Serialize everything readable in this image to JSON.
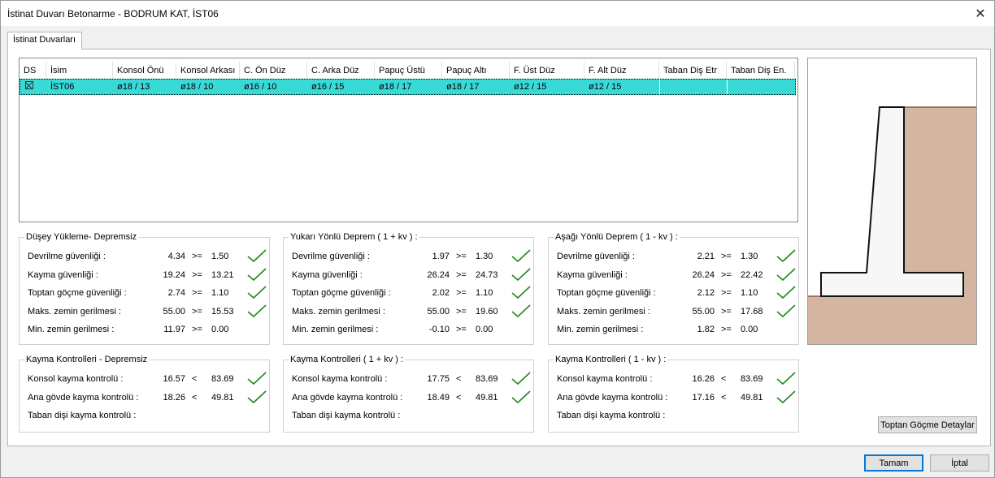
{
  "window": {
    "title": "İstinat Duvarı Betonarme - BODRUM KAT, İST06",
    "close_glyph": "✕"
  },
  "tab": {
    "label": "İstinat Duvarları"
  },
  "grid": {
    "columns": [
      "DS",
      "İsim",
      "Konsol Önü",
      "Konsol Arkası",
      "C. Ön Düz",
      "C. Arka Düz",
      "Papuç Üstü",
      "Papuç Altı",
      "F. Üst Düz",
      "F. Alt Düz",
      "Taban Diş Etr",
      "Taban Diş En."
    ],
    "row": {
      "name": "İST06",
      "konsol_onu": "ø18 / 13",
      "konsol_arkasi": "ø18 / 10",
      "c_on_duz": "ø16 / 10",
      "c_arka_duz": "ø16 / 15",
      "papuc_ustu": "ø18 / 17",
      "papuc_alti": "ø18 / 17",
      "f_ust_duz": "ø12 / 15",
      "f_alt_duz": "ø12 / 15",
      "taban_dis_etr": "",
      "taban_dis_en": ""
    }
  },
  "groups": {
    "dusey": {
      "title": "Düşey Yükleme- Depremsiz",
      "rows": [
        {
          "label": "Devrilme güvenliği :",
          "v1": "4.34",
          "op": ">=",
          "v2": "1.50"
        },
        {
          "label": "Kayma güvenliği :",
          "v1": "19.24",
          "op": ">=",
          "v2": "13.21"
        },
        {
          "label": "Toptan göçme güvenliği :",
          "v1": "2.74",
          "op": ">=",
          "v2": "1.10"
        },
        {
          "label": "Maks. zemin gerilmesi :",
          "v1": "55.00",
          "op": ">=",
          "v2": "15.53"
        },
        {
          "label": "Min. zemin gerilmesi :",
          "v1": "11.97",
          "op": ">=",
          "v2": "0.00"
        }
      ]
    },
    "yukari": {
      "title": "Yukarı Yönlü Deprem ( 1 + kv ) :",
      "rows": [
        {
          "label": "Devrilme güvenliği :",
          "v1": "1.97",
          "op": ">=",
          "v2": "1.30"
        },
        {
          "label": "Kayma güvenliği :",
          "v1": "26.24",
          "op": ">=",
          "v2": "24.73"
        },
        {
          "label": "Toptan göçme güvenliği :",
          "v1": "2.02",
          "op": ">=",
          "v2": "1.10"
        },
        {
          "label": "Maks. zemin gerilmesi :",
          "v1": "55.00",
          "op": ">=",
          "v2": "19.60"
        },
        {
          "label": "Min. zemin gerilmesi :",
          "v1": "-0.10",
          "op": ">=",
          "v2": "0.00"
        }
      ]
    },
    "asagi": {
      "title": "Aşağı Yönlü Deprem ( 1 - kv ) :",
      "rows": [
        {
          "label": "Devrilme güvenliği :",
          "v1": "2.21",
          "op": ">=",
          "v2": "1.30"
        },
        {
          "label": "Kayma güvenliği :",
          "v1": "26.24",
          "op": ">=",
          "v2": "22.42"
        },
        {
          "label": "Toptan göçme güvenliği :",
          "v1": "2.12",
          "op": ">=",
          "v2": "1.10"
        },
        {
          "label": "Maks. zemin gerilmesi :",
          "v1": "55.00",
          "op": ">=",
          "v2": "17.68"
        },
        {
          "label": "Min. zemin gerilmesi :",
          "v1": "1.82",
          "op": ">=",
          "v2": "0.00"
        }
      ]
    },
    "kayma_depremsiz": {
      "title": "Kayma Kontrolleri - Depremsiz",
      "rows": [
        {
          "label": "Konsol kayma kontrolü :",
          "v1": "16.57",
          "op": "<",
          "v2": "83.69"
        },
        {
          "label": "Ana gövde kayma kontrolü :",
          "v1": "18.26",
          "op": "<",
          "v2": "49.81"
        },
        {
          "label": "Taban dişi kayma kontrolü :",
          "v1": "",
          "op": "",
          "v2": ""
        }
      ]
    },
    "kayma_yukari": {
      "title": "Kayma Kontrolleri  ( 1 + kv ) :",
      "rows": [
        {
          "label": "Konsol kayma kontrolü :",
          "v1": "17.75",
          "op": "<",
          "v2": "83.69"
        },
        {
          "label": "Ana gövde kayma kontrolü :",
          "v1": "18.49",
          "op": "<",
          "v2": "49.81"
        },
        {
          "label": "Taban dişi kayma kontrolü :",
          "v1": "",
          "op": "",
          "v2": ""
        }
      ]
    },
    "kayma_asagi": {
      "title": "Kayma Kontrolleri  ( 1 - kv ) :",
      "rows": [
        {
          "label": "Konsol kayma kontrolü :",
          "v1": "16.26",
          "op": "<",
          "v2": "83.69"
        },
        {
          "label": "Ana gövde kayma kontrolü :",
          "v1": "17.16",
          "op": "<",
          "v2": "49.81"
        },
        {
          "label": "Taban dişi kayma kontrolü :",
          "v1": "",
          "op": "",
          "v2": ""
        }
      ]
    }
  },
  "buttons": {
    "toptan": "Toptan Göçme Detaylar",
    "ok": "Tamam",
    "cancel": "İptal"
  },
  "colors": {
    "selection": "#39d9d6",
    "soil": "#d4b5a2",
    "check": "#1e8a1e",
    "accent": "#0078d7"
  },
  "icons": {
    "check": "check-mark-icon",
    "close": "close-icon",
    "checkbox": "checked-box-icon"
  }
}
